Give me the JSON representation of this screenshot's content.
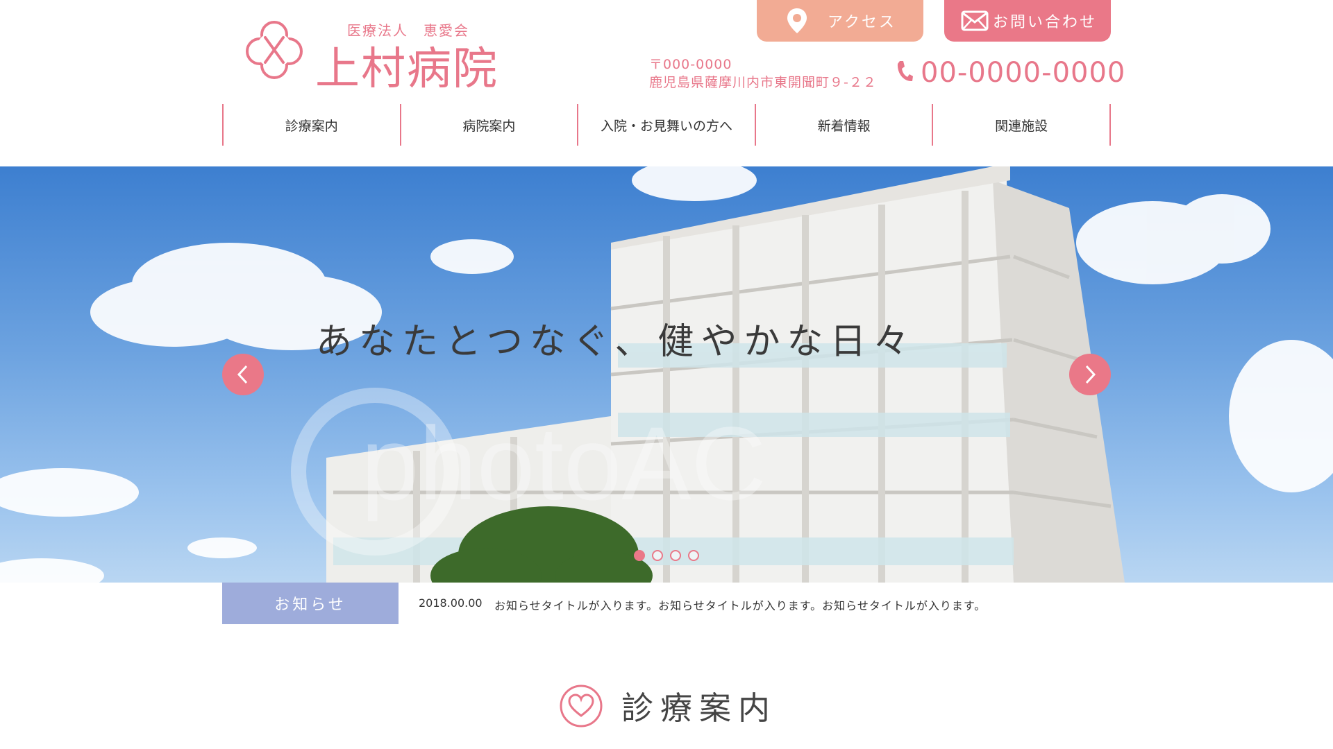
{
  "brand": {
    "corp": "医療法人　恵愛会",
    "name": "上村病院",
    "accent": "#e8778a"
  },
  "top_buttons": {
    "access_label": "アクセス",
    "access_icon": "map-pin-icon",
    "contact_label": "お問い合わせ",
    "contact_icon": "mail-icon"
  },
  "contact": {
    "postal": "〒000-0000",
    "address": "鹿児島県薩摩川内市東開聞町９-２２",
    "phone": "00-0000-0000",
    "phone_icon": "phone-icon"
  },
  "nav": {
    "items": [
      {
        "label": "診療案内"
      },
      {
        "label": "病院案内"
      },
      {
        "label": "入院・お見舞いの方へ"
      },
      {
        "label": "新着情報"
      },
      {
        "label": "関連施設"
      }
    ]
  },
  "hero": {
    "catch": "あなたとつなぐ、健やかな日々",
    "watermark": "photoAC",
    "slide_count": 4,
    "active_slide": 1
  },
  "news": {
    "label": "お知らせ",
    "date": "2018.00.00",
    "title": "お知らせタイトルが入ります。お知らせタイトルが入ります。お知らせタイトルが入ります。"
  },
  "section": {
    "title": "診療案内",
    "icon": "heart-icon"
  },
  "colors": {
    "pink": "#ea7888",
    "salmon": "#f2ab94",
    "news_blue": "#9eacdb"
  }
}
